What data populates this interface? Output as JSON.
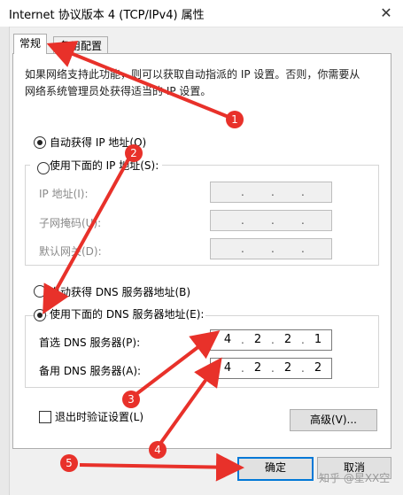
{
  "window": {
    "title": "Internet 协议版本 4 (TCP/IPv4) 属性",
    "close_icon": "close-icon"
  },
  "tabs": [
    {
      "label": "常规"
    },
    {
      "label": "备用配置"
    }
  ],
  "description": "如果网络支持此功能，则可以获取自动指派的 IP 设置。否则，你需要从网络系统管理员处获得适当的 IP 设置。",
  "ip_section": {
    "auto_label": "自动获得 IP 地址(O)",
    "manual_label": "使用下面的 IP 地址(S):",
    "fields": [
      {
        "label": "IP 地址(I):"
      },
      {
        "label": "子网掩码(U):"
      },
      {
        "label": "默认网关(D):"
      }
    ]
  },
  "dns_section": {
    "auto_label": "自动获得 DNS 服务器地址(B)",
    "manual_label": "使用下面的 DNS 服务器地址(E):",
    "preferred": {
      "label": "首选 DNS 服务器(P):",
      "octets": [
        "4",
        "2",
        "2",
        "1"
      ]
    },
    "alternate": {
      "label": "备用 DNS 服务器(A):",
      "octets": [
        "4",
        "2",
        "2",
        "2"
      ]
    }
  },
  "validate_label": "退出时验证设置(L)",
  "advanced_label": "高级(V)...",
  "ok_label": "确定",
  "cancel_label": "取消",
  "annotations": [
    "1",
    "2",
    "3",
    "4",
    "5"
  ],
  "watermark": "知乎 @星XX空",
  "colors": {
    "annotation": "#e8312a",
    "focus": "#0078d7"
  }
}
